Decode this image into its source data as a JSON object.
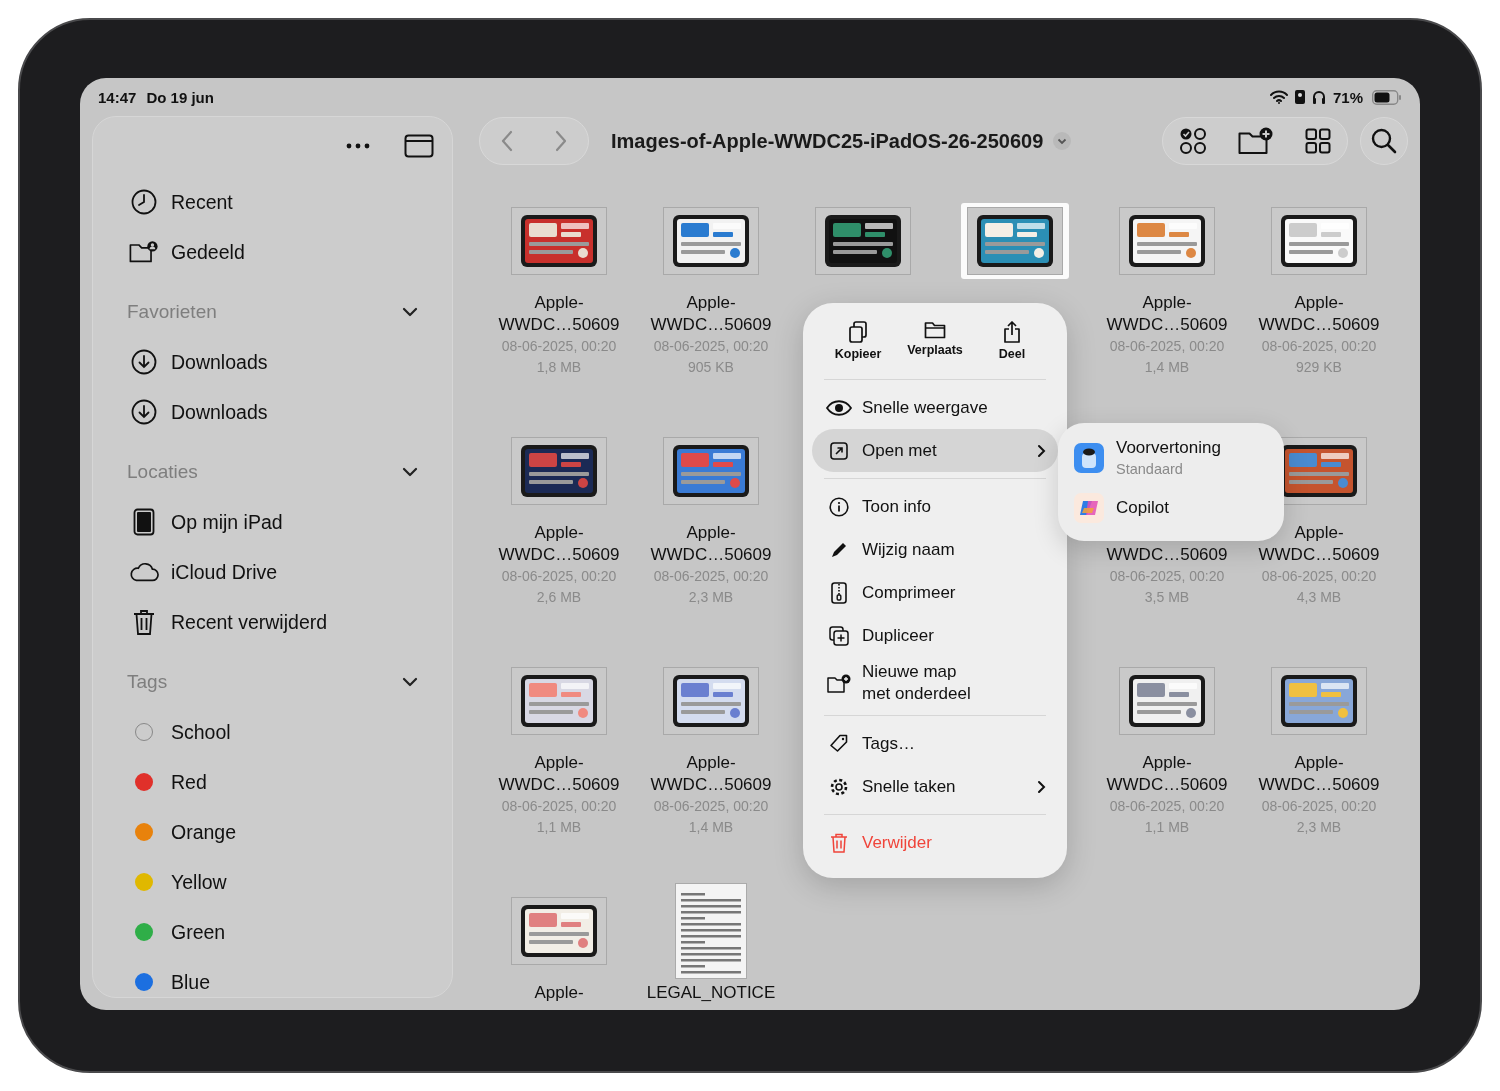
{
  "status_bar": {
    "time": "14:47",
    "date": "Do 19 jun",
    "battery": "71%"
  },
  "sidebar": {
    "sections": [
      {
        "items": [
          {
            "label": "Recent",
            "kind": "recent"
          },
          {
            "label": "Gedeeld",
            "kind": "shared"
          }
        ]
      },
      {
        "title": "Favorieten",
        "expanded": true,
        "items": [
          {
            "label": "Downloads",
            "kind": "download"
          },
          {
            "label": "Downloads",
            "kind": "download"
          }
        ]
      },
      {
        "title": "Locaties",
        "expanded": true,
        "items": [
          {
            "label": "Op mijn iPad",
            "kind": "device"
          },
          {
            "label": "iCloud Drive",
            "kind": "cloud"
          },
          {
            "label": "Recent verwijderd",
            "kind": "trash"
          }
        ]
      },
      {
        "title": "Tags",
        "expanded": true,
        "items": [
          {
            "label": "School",
            "kind": "tag"
          },
          {
            "label": "Red",
            "kind": "tag",
            "color": "#e0302a"
          },
          {
            "label": "Orange",
            "kind": "tag",
            "color": "#e8820c"
          },
          {
            "label": "Yellow",
            "kind": "tag",
            "color": "#e0b800"
          },
          {
            "label": "Green",
            "kind": "tag",
            "color": "#2fae48"
          },
          {
            "label": "Blue",
            "kind": "tag",
            "color": "#1c6fe0"
          }
        ]
      }
    ]
  },
  "toolbar": {
    "title": "Images-of-Apple-WWDC25-iPadOS-26-250609"
  },
  "files": [
    {
      "name": "Apple-WWDC…50609",
      "date": "08-06-2025, 00:20",
      "size": "1,8 MB",
      "selected": false
    },
    {
      "name": "Apple-WWDC…50609",
      "date": "08-06-2025, 00:20",
      "size": "905 KB",
      "selected": false
    },
    {
      "kind": "image-only",
      "selected": false
    },
    {
      "kind": "image-only",
      "selected": true
    },
    {
      "name": "Apple-WWDC…50609",
      "date": "08-06-2025, 00:20",
      "size": "1,4 MB",
      "selected": false
    },
    {
      "name": "Apple-WWDC…50609",
      "date": "08-06-2025, 00:20",
      "size": "929 KB",
      "selected": false
    },
    {
      "name": "Apple-WWDC…50609",
      "date": "08-06-2025, 00:20",
      "size": "2,6 MB",
      "selected": false
    },
    {
      "name": "Apple-WWDC…50609",
      "date": "08-06-2025, 00:20",
      "size": "2,3 MB",
      "selected": false
    },
    {
      "kind": "covered"
    },
    {
      "kind": "covered"
    },
    {
      "kind": "text-only",
      "name": "WWDC…50609",
      "date": "08-06-2025, 00:20",
      "size": "3,5 MB"
    },
    {
      "name": "Apple-WWDC…50609",
      "date": "08-06-2025, 00:20",
      "size": "4,3 MB",
      "selected": false
    },
    {
      "name": "Apple-WWDC…50609",
      "date": "08-06-2025, 00:20",
      "size": "1,1 MB",
      "selected": false
    },
    {
      "name": "Apple-WWDC…50609",
      "date": "08-06-2025, 00:20",
      "size": "1,4 MB",
      "selected": false
    },
    {
      "kind": "covered"
    },
    {
      "kind": "covered"
    },
    {
      "name": "Apple-WWDC…50609",
      "date": "08-06-2025, 00:20",
      "size": "1,1 MB",
      "selected": false
    },
    {
      "name": "Apple-WWDC…50609",
      "date": "08-06-2025, 00:20",
      "size": "2,3 MB",
      "selected": false
    },
    {
      "name": "Apple-",
      "selected": false
    },
    {
      "kind": "document",
      "name": "LEGAL_NOTICE",
      "selected": false
    }
  ],
  "context_menu": {
    "actions": [
      {
        "label": "Kopieer",
        "kind": "copy"
      },
      {
        "label": "Verplaats",
        "kind": "move"
      },
      {
        "label": "Deel",
        "kind": "share"
      }
    ],
    "groups": [
      [
        {
          "label": "Snelle weergave",
          "kind": "eye",
          "submenu": false,
          "selected": false
        },
        {
          "label": "Open met",
          "kind": "open",
          "submenu": true,
          "selected": true
        }
      ],
      [
        {
          "label": "Toon info",
          "kind": "info",
          "submenu": false,
          "selected": false
        },
        {
          "label": "Wijzig naam",
          "kind": "pencil",
          "submenu": false,
          "selected": false
        },
        {
          "label": "Comprimeer",
          "kind": "zip",
          "submenu": false,
          "selected": false
        },
        {
          "label": "Dupliceer",
          "kind": "duplicate",
          "submenu": false,
          "selected": false
        },
        {
          "label": "Nieuwe map\nmet onderdeel",
          "kind": "folder-plus",
          "submenu": false,
          "selected": false
        }
      ],
      [
        {
          "label": "Tags…",
          "kind": "tag",
          "submenu": false,
          "selected": false
        },
        {
          "label": "Snelle taken",
          "kind": "gear",
          "submenu": true,
          "selected": false
        }
      ],
      [
        {
          "label": "Verwijder",
          "kind": "trash",
          "submenu": false,
          "selected": false,
          "destructive": true
        }
      ]
    ]
  },
  "submenu": {
    "items": [
      {
        "label": "Voorvertoning",
        "sublabel": "Standaard",
        "kind": "preview"
      },
      {
        "label": "Copilot",
        "kind": "copilot"
      }
    ]
  }
}
